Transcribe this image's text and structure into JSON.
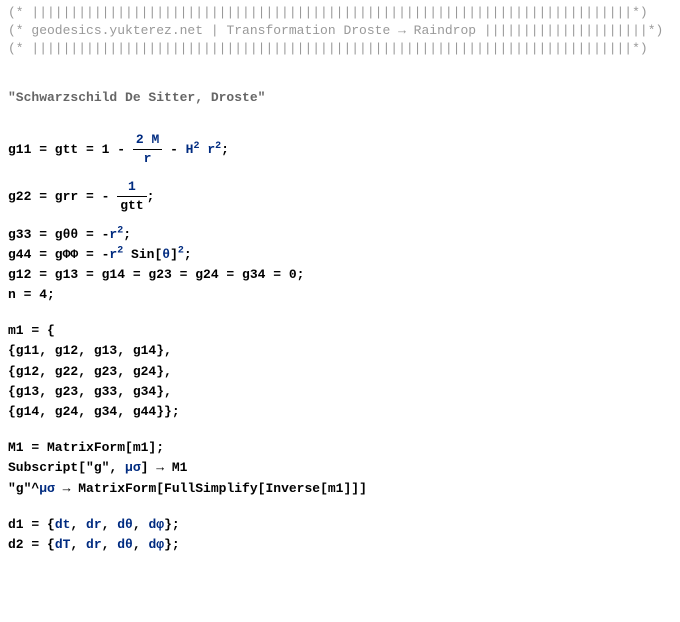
{
  "comments": {
    "bars1_pre": "(* ",
    "bars1_post": "*)",
    "header_pre": "(* ",
    "header_text": "geodesics.yukterez.net | Transformation Droste → Raindrop ",
    "header_post": "*)",
    "bars2_pre": "(* ",
    "bars2_post": "*)"
  },
  "title": "\"Schwarzschild De Sitter, Droste\"",
  "metric": {
    "g11_lhs": "g11 = gtt = 1 - ",
    "g11_frac_top_a": "2",
    "g11_frac_top_b": "M",
    "g11_frac_bot": "r",
    "g11_mid": " - ",
    "g11_H": "H",
    "g11_H_exp": "2",
    "g11_sp": " ",
    "g11_r": "r",
    "g11_r_exp": "2",
    "g11_end": ";",
    "g22_lhs": "g22 = grr = - ",
    "g22_top": "1",
    "g22_bot": "gtt",
    "g22_end": ";",
    "g33_lhs": "g33 = gθθ = -",
    "g33_r": "r",
    "g33_r_exp": "2",
    "g33_end": ";",
    "g44_lhs": "g44 = gΦΦ = -",
    "g44_r": "r",
    "g44_r_exp": "2",
    "g44_sin": " Sin[",
    "g44_theta": "θ",
    "g44_close": "]",
    "g44_exp": "2",
    "g44_end": ";",
    "zeros": "g12 = g13 = g14 = g23 = g24 = g34 = 0;",
    "n": "n = 4;"
  },
  "matrix": {
    "m1_open": "m1 = {",
    "row1": "{g11, g12, g13, g14},",
    "row2": "{g12, g22, g23, g24},",
    "row3": "{g13, g23, g33, g34},",
    "row4": "{g14, g24, g34, g44}};"
  },
  "forms": {
    "M1": "M1 = MatrixForm[m1];",
    "sub_a": "Subscript[\"g\", ",
    "sub_b": "μσ",
    "sub_c": "] → M1",
    "inv_a": "\"g\"^",
    "inv_b": "μσ",
    "inv_c": " →  MatrixForm[FullSimplify[Inverse[m1]]]"
  },
  "diffs": {
    "d1_a": "d1 = {",
    "d1_b": "dt",
    "d1_c": ", ",
    "d1_d": "dr",
    "d1_e": ", ",
    "d1_f": "dθ",
    "d1_g": ", ",
    "d1_h": "dφ",
    "d1_i": "};",
    "d2_a": "d2 = {",
    "d2_b": "dT",
    "d2_c": ", ",
    "d2_d": "dr",
    "d2_e": ", ",
    "d2_f": "dθ",
    "d2_g": ", ",
    "d2_h": "dφ",
    "d2_i": "};"
  }
}
